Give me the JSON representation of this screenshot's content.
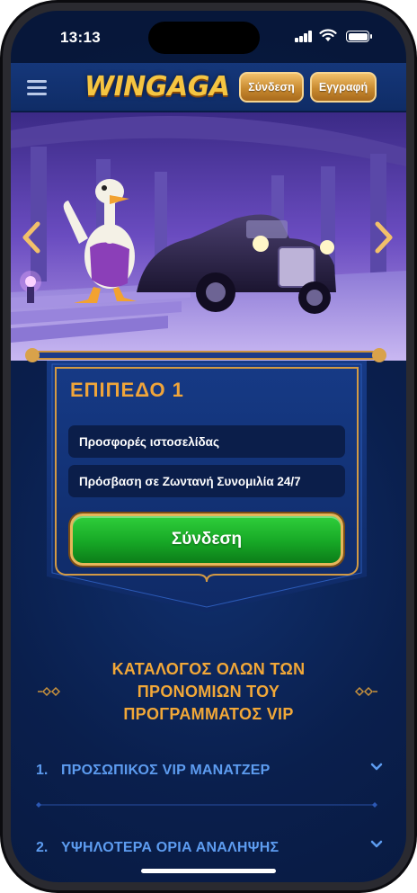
{
  "status_bar": {
    "time": "13:13"
  },
  "header": {
    "logo_text": "WINGAGA",
    "login_label": "Σύνδεση",
    "register_label": "Εγγραφή"
  },
  "level_card": {
    "title": "ΕΠΙΠΕΔΟ 1",
    "perks": [
      "Προσφορές ιστοσελίδας",
      "Πρόσβαση σε Ζωντανή Συνομιλία 24/7"
    ],
    "cta_label": "Σύνδεση"
  },
  "vip_catalog": {
    "title_lines": [
      "ΚΑΤΑΛΟΓΟΣ ΟΛΩΝ ΤΩΝ",
      "ΠΡΟΝΟΜΙΩΝ ΤΟΥ",
      "ΠΡΟΓΡΑΜΜΑΤΟΣ VIP"
    ],
    "items": [
      {
        "number": "1.",
        "label": "ΠΡΟΣΩΠΙΚΟΣ VIP ΜΑΝΑΤΖΕΡ"
      },
      {
        "number": "2.",
        "label": "ΥΨΗΛΟΤΕΡΑ ΟΡΙΑ ΑΝΑΛΗΨΗΣ"
      }
    ]
  },
  "colors": {
    "background": "#0a1f4d",
    "accent_gold": "#f2a838",
    "link_blue": "#5d9cf0",
    "cta_green": "#17a826"
  },
  "icons": [
    "menu-icon",
    "chevron-left-icon",
    "chevron-right-icon",
    "chevron-down-icon",
    "diamond-deco-icon",
    "signal-icon",
    "wifi-icon",
    "battery-icon"
  ]
}
